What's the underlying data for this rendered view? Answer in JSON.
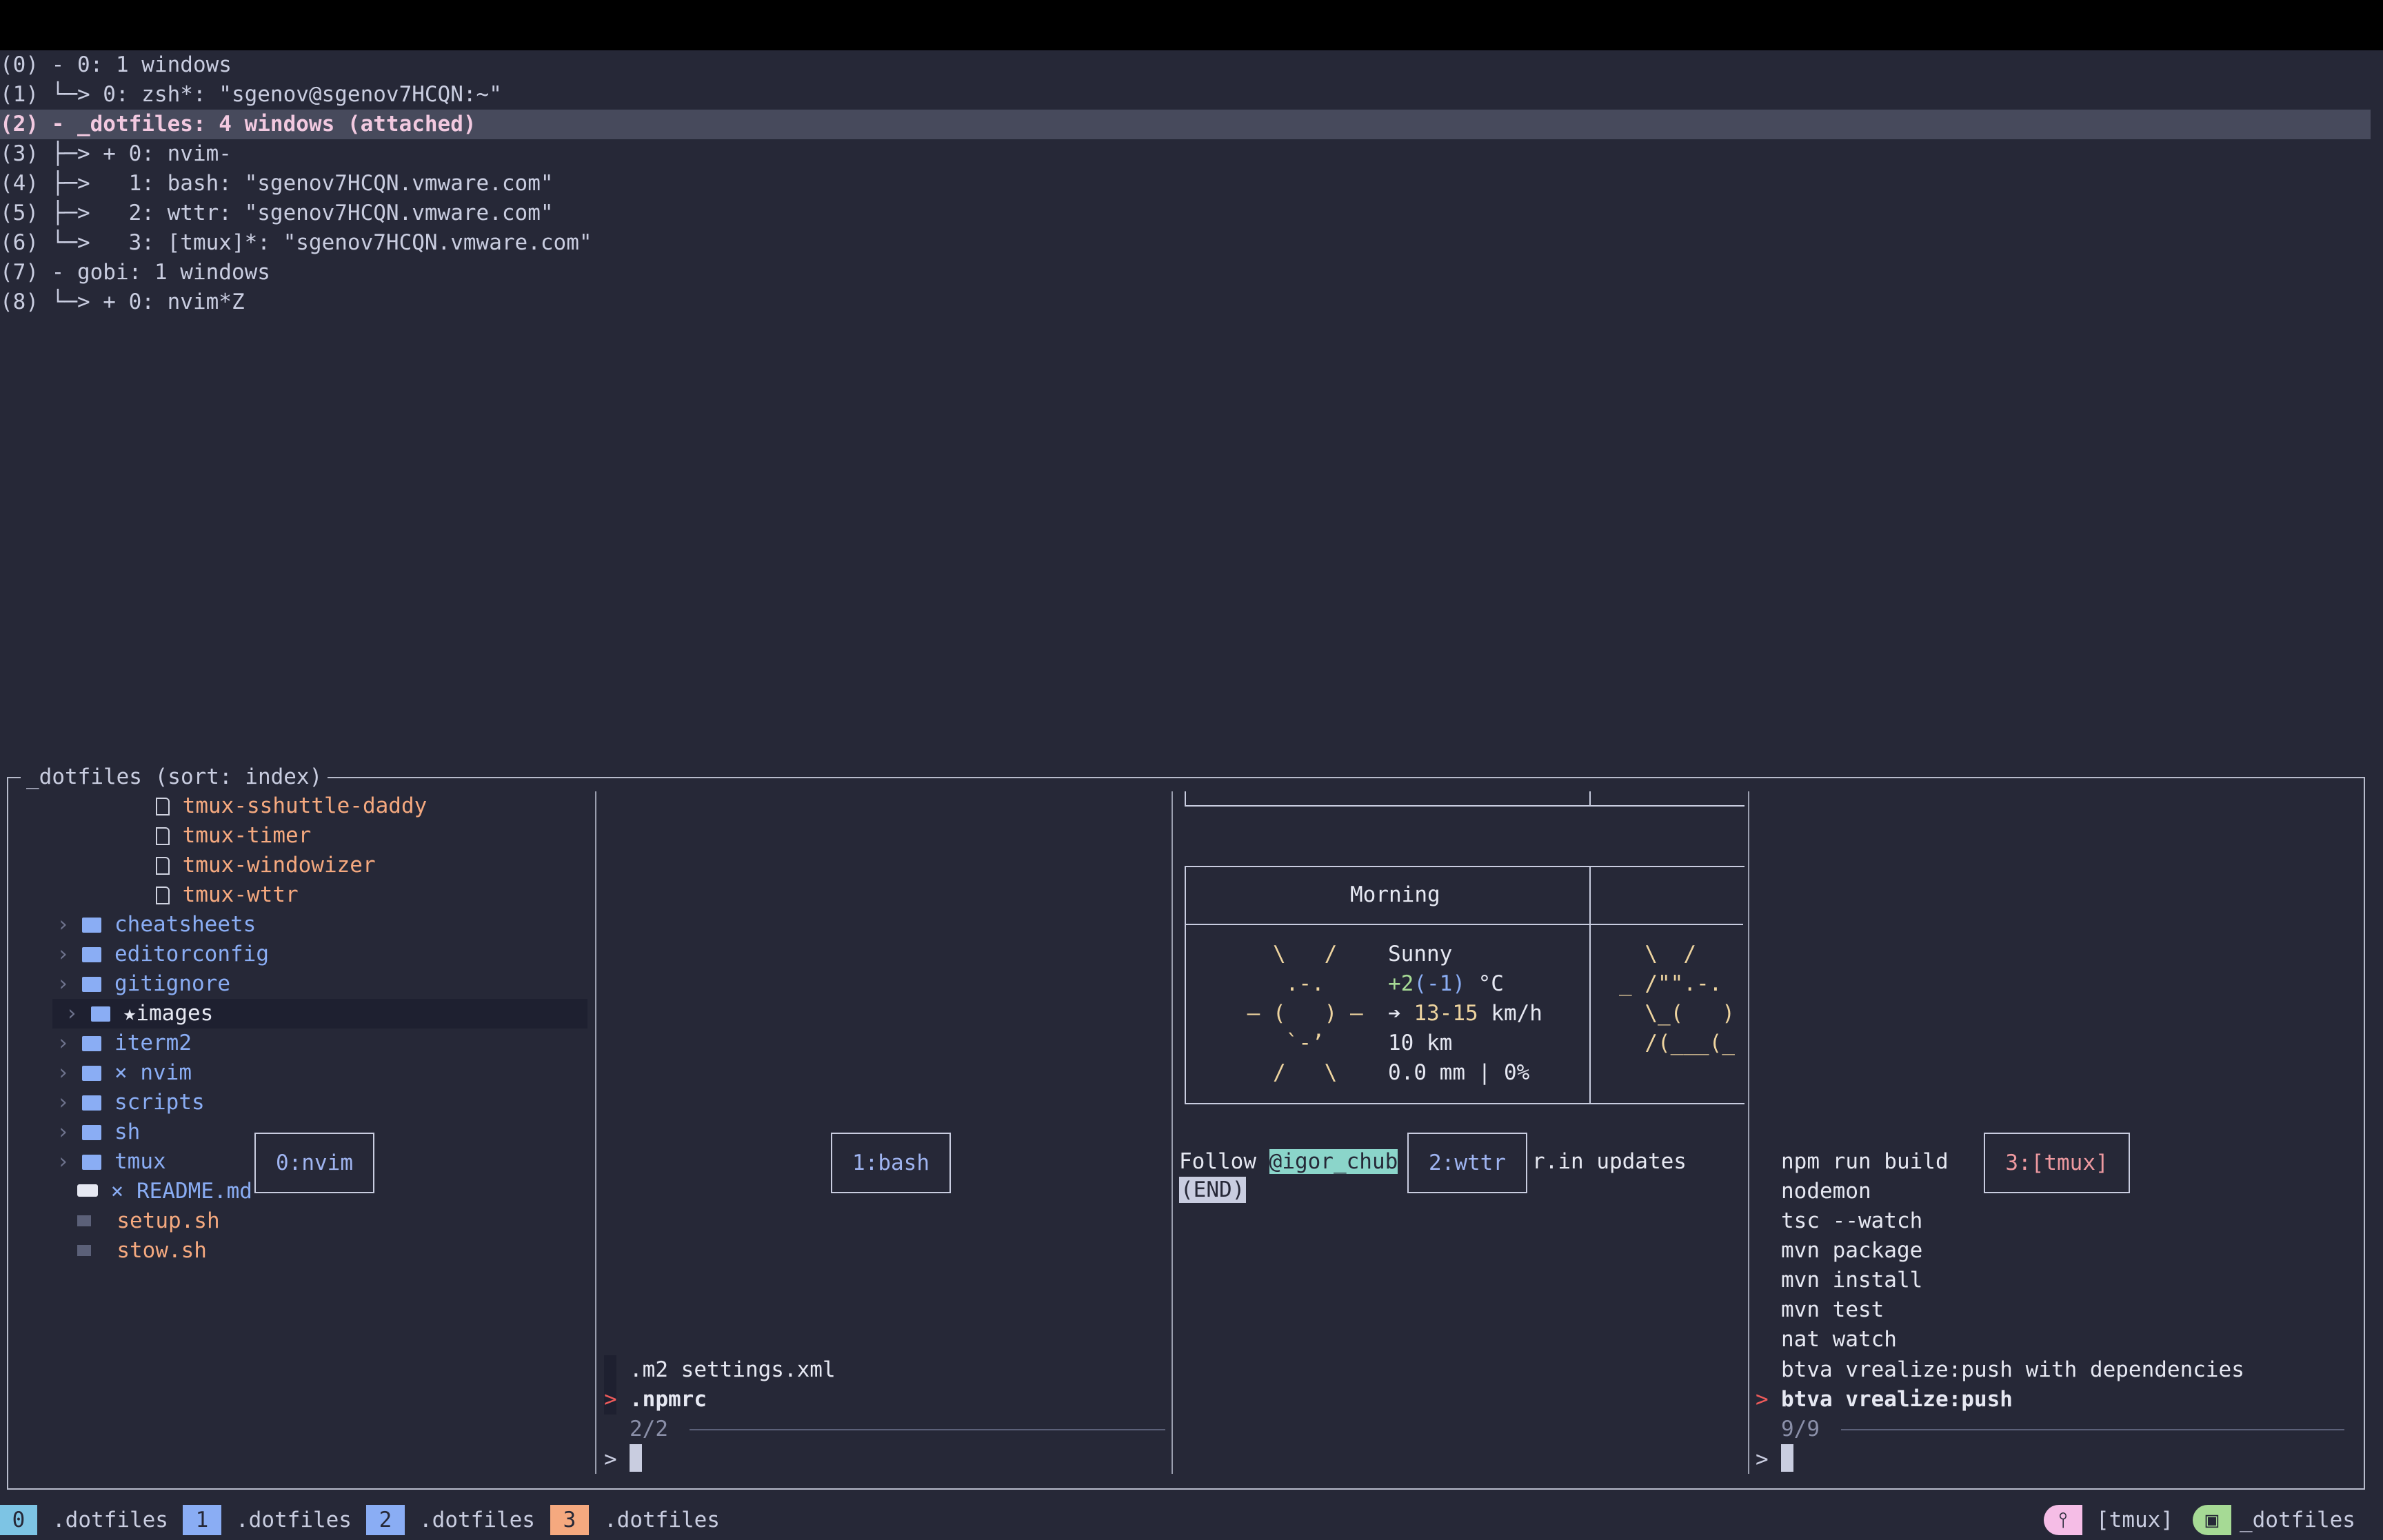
{
  "session_tree": [
    "(0) - 0: 1 windows",
    "(1) └─> 0: zsh*: \"sgenov@sgenov7HCQN:~\"",
    "(2) - _dotfiles: 4 windows (attached)",
    "(3) ├─> + 0: nvim-",
    "(4) ├─>   1: bash: \"sgenov7HCQN.vmware.com\"",
    "(5) ├─>   2: wttr: \"sgenov7HCQN.vmware.com\"",
    "(6) └─>   3: [tmux]*: \"sgenov7HCQN.vmware.com\"",
    "(7) - gobi: 1 windows",
    "(8) └─> + 0: nvim*Z"
  ],
  "preview": {
    "title": "_dotfiles (sort: index)"
  },
  "pane0": {
    "label": "0:nvim",
    "subfiles": [
      "tmux-sshuttle-daddy",
      "tmux-timer",
      "tmux-windowizer",
      "tmux-wttr"
    ],
    "folders": [
      {
        "name": "cheatsheets",
        "mark": ""
      },
      {
        "name": "editorconfig",
        "mark": ""
      },
      {
        "name": "gitignore",
        "mark": ""
      },
      {
        "name": "images",
        "mark": "★"
      },
      {
        "name": "iterm2",
        "mark": ""
      },
      {
        "name": "nvim",
        "mark": "× "
      },
      {
        "name": "scripts",
        "mark": ""
      },
      {
        "name": "sh",
        "mark": ""
      },
      {
        "name": "tmux",
        "mark": ""
      }
    ],
    "files": [
      {
        "name": "README.md",
        "mark": "× "
      },
      {
        "name": "setup.sh"
      },
      {
        "name": "stow.sh"
      }
    ]
  },
  "pane1": {
    "label": "1:bash",
    "items": [
      ".m2 settings.xml",
      ".npmrc"
    ],
    "selected": ".npmrc",
    "count": "2/2",
    "prompt": ">"
  },
  "pane2": {
    "label": "2:wttr",
    "period": "Morning",
    "condition": "Sunny",
    "temp_value": "+2",
    "temp_feels": "(-1)",
    "temp_unit": " °C",
    "wind_arrow": "➔ ",
    "wind_value": "13-15",
    "wind_unit": " km/h",
    "visibility": "10 km",
    "precip": "0.0 mm | 0%",
    "follow_prefix": "Follow ",
    "follow_handle": "@igor_chub",
    "follow_suffix": "r.in updates",
    "end_marker": "(END)"
  },
  "pane3": {
    "label": "3:[tmux]",
    "items": [
      "npm run build",
      "nodemon",
      "tsc --watch",
      "mvn package",
      "mvn install",
      "mvn test",
      "nat watch",
      "btva vrealize:push with dependencies",
      "btva vrealize:push"
    ],
    "count": "9/9",
    "prompt": ">"
  },
  "statusbar": {
    "tabs": [
      {
        "num": "0",
        "name": ".dotfiles"
      },
      {
        "num": "1",
        "name": ".dotfiles"
      },
      {
        "num": "2",
        "name": ".dotfiles"
      },
      {
        "num": "3",
        "name": ".dotfiles"
      }
    ],
    "right_mode": "[tmux]",
    "right_session": "_dotfiles"
  },
  "colors": {
    "background": "#262837",
    "selection": "#474a5c",
    "accent_blue": "#8aadf4",
    "accent_orange": "#f5a97f",
    "accent_pink": "#f5bde6",
    "accent_green": "#a6da95"
  }
}
